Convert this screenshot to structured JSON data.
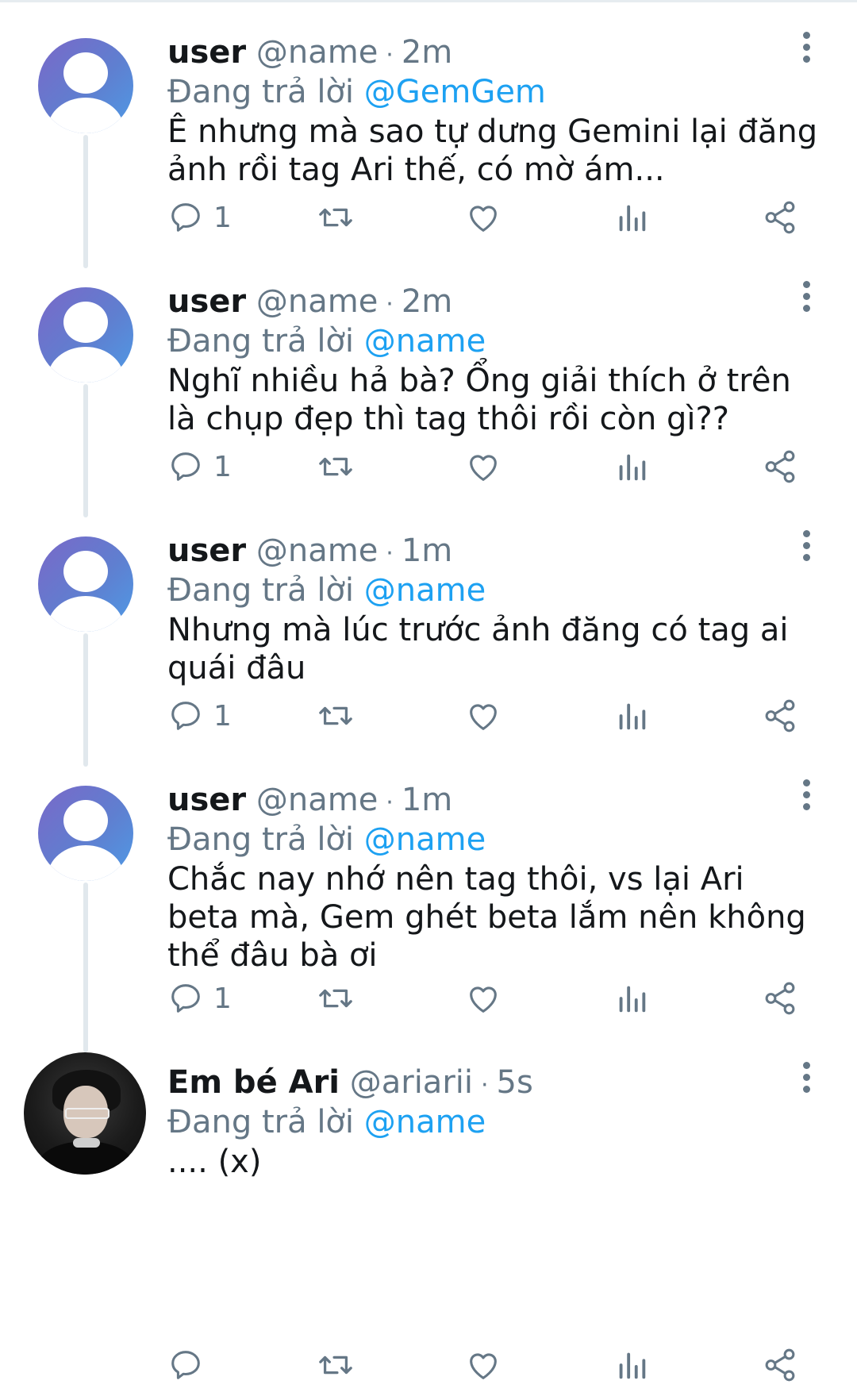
{
  "tweets": [
    {
      "author": "user",
      "handle": "@name",
      "time": "2m",
      "reply_prefix": "Đang trả lời",
      "reply_to": "@GemGem",
      "text": "Ê nhưng mà sao tự dưng Gemini lại đăng ảnh rồi tag Ari thế, có mờ ám...",
      "reply_count": "1",
      "avatar": "default-avatar"
    },
    {
      "author": "user",
      "handle": "@name",
      "time": "2m",
      "reply_prefix": "Đang trả lời",
      "reply_to": "@name",
      "text": "Nghĩ nhiều hả bà? Ổng giải thích ở trên là chụp đẹp thì tag thôi rồi còn gì??",
      "reply_count": "1",
      "avatar": "default-avatar"
    },
    {
      "author": "user",
      "handle": "@name",
      "time": "1m",
      "reply_prefix": "Đang trả lời",
      "reply_to": "@name",
      "text": "Nhưng mà lúc trước ảnh đăng có tag ai quái đâu",
      "reply_count": "1",
      "avatar": "default-avatar"
    },
    {
      "author": "user",
      "handle": "@name",
      "time": "1m",
      "reply_prefix": "Đang trả lời",
      "reply_to": "@name",
      "text": "Chắc nay nhớ nên tag thôi, vs lại Ari beta mà, Gem ghét beta lắm nên không thể đâu bà ơi",
      "reply_count": "1",
      "avatar": "default-avatar"
    },
    {
      "author": "Em bé Ari",
      "handle": "@ariarii",
      "time": "5s",
      "reply_prefix": "Đang trả lời",
      "reply_to": "@name",
      "text": ".... (x)",
      "reply_count": "",
      "avatar": "photo-avatar"
    }
  ],
  "colors": {
    "accent": "#1da1f2",
    "secondary_text": "#657786",
    "thread_line": "#e1e8ed"
  },
  "icons": [
    "reply-icon",
    "retweet-icon",
    "like-icon",
    "analytics-icon",
    "share-icon",
    "more-options-icon"
  ]
}
